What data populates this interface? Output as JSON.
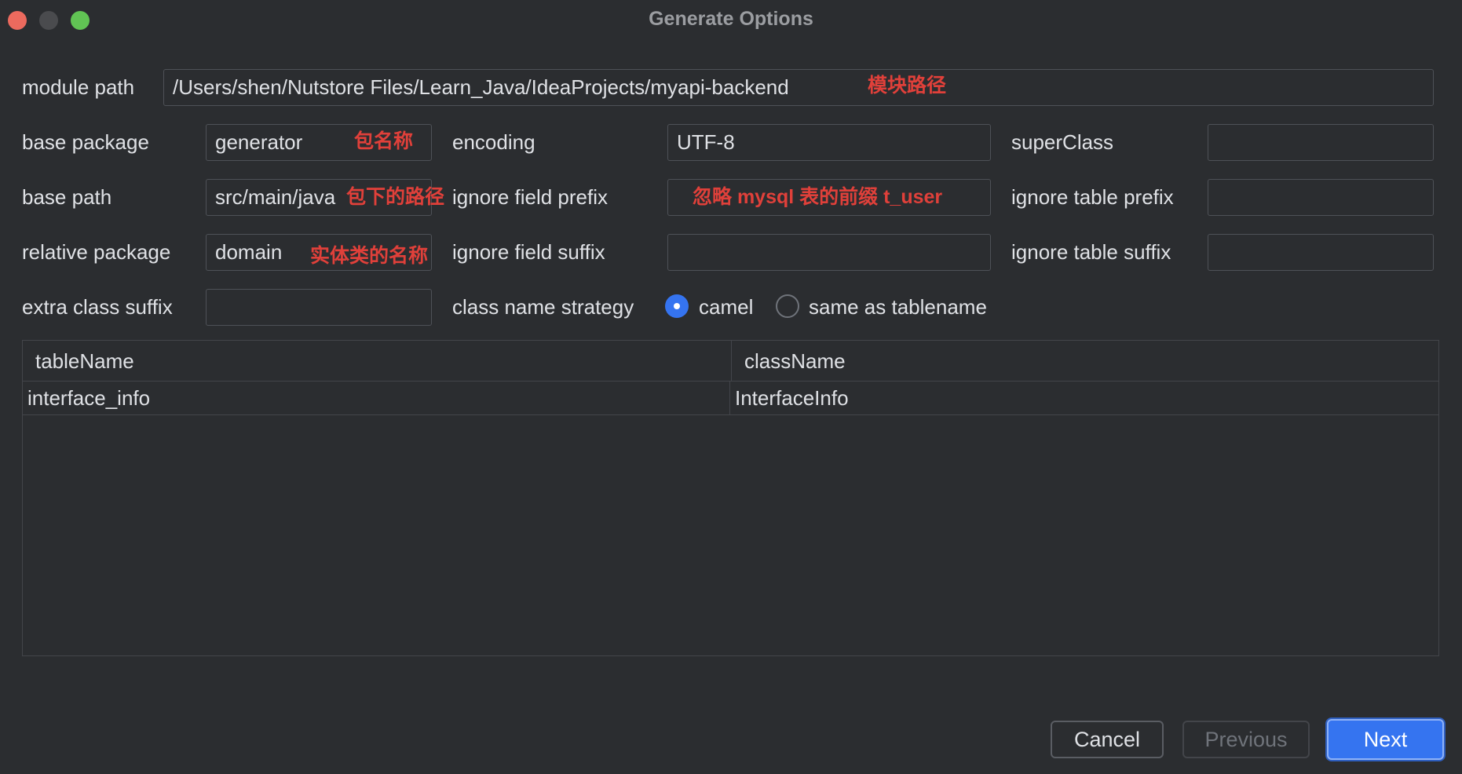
{
  "window": {
    "title": "Generate Options"
  },
  "module_path": {
    "label": "module path",
    "value": "/Users/shen/Nutstore Files/Learn_Java/IdeaProjects/myapi-backend",
    "note": "模块路径"
  },
  "base_package": {
    "label": "base package",
    "value": "generator",
    "note": "包名称"
  },
  "base_path": {
    "label": "base path",
    "value": "src/main/java",
    "note": "包下的路径"
  },
  "relative_package": {
    "label": "relative package",
    "value": "domain",
    "note": "实体类的名称"
  },
  "extra_class_suffix": {
    "label": "extra class suffix",
    "value": ""
  },
  "encoding": {
    "label": "encoding",
    "value": "UTF-8"
  },
  "ignore_field_prefix": {
    "label": "ignore field prefix",
    "value": "",
    "note": "忽略 mysql 表的前缀 t_user"
  },
  "ignore_field_suffix": {
    "label": "ignore field suffix",
    "value": ""
  },
  "class_name_strategy": {
    "label": "class name strategy",
    "options": [
      "camel",
      "same as tablename"
    ],
    "selected": "camel"
  },
  "super_class": {
    "label": "superClass",
    "value": ""
  },
  "ignore_table_prefix": {
    "label": "ignore table prefix",
    "value": ""
  },
  "ignore_table_suffix": {
    "label": "ignore table suffix",
    "value": ""
  },
  "table": {
    "columns": [
      "tableName",
      "className"
    ],
    "rows": [
      [
        "interface_info",
        "InterfaceInfo"
      ]
    ]
  },
  "buttons": {
    "cancel": "Cancel",
    "previous": "Previous",
    "next": "Next"
  },
  "colors": {
    "background": "#2b2d30",
    "accent": "#3574f0",
    "annotation": "#e0403a"
  }
}
